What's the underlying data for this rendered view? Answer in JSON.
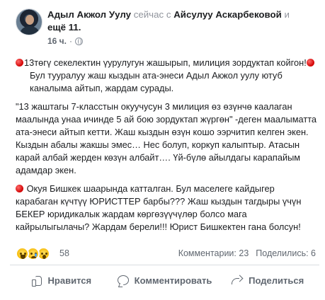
{
  "post": {
    "author": "Адыл Акжол Уулу",
    "with_prefix": "сейчас с",
    "tagged": "Айсулуу Аскарбековой",
    "and_text": "и",
    "others": "ещё 11",
    "period": ".",
    "time": "16 ч.",
    "middot": "·",
    "privacy_icon": "globe-icon",
    "paragraphs": [
      "13төгү секелектин үурулугун жашырып, милиция зордуктап койгон!",
      "Бул тууралуу жаш кыздын ата-энеси Адыл Акжол уулу ютуб каналыма айтып, жардам сурады.",
      "\"13 жаштагы 7-класстын окуучусун 3 милиция өз өзүнчө каалаган маалында унаа ичинде 5 ай бою зордуктап жүргөн\" -деген маалыматта ата-энеси айтып кетти. Жаш кыздын өзүн кошо ээрчитип келген экен. Кыздын абалы жакшы эмес… Нес болуп, коркуп калыптыр. Атасын карай албай жерден көзүн албайт…. Үй-бүлө айылдагы карапайым адамдар экен.",
      "Окуя Бишкек шаарында катталган. Бул маселеге кайдыгер карабаган күчтүү ЮРИСТТЕР барбы??? Жаш кыздын тагдыры үчүн БЕКЕР юридикалык жардам көргөзүүчүлөр болсо мага кайрылыгылачы?  Жардам берели!!! Юрист Бишкектен гана болсун!"
    ],
    "emoji_red_circle": "red-circle-emoji"
  },
  "engagement": {
    "reaction_icons": [
      "haha-reaction",
      "sad-reaction",
      "wow-reaction"
    ],
    "reaction_count": "58",
    "comments": "Комментарии: 23",
    "shares": "Поделились: 6"
  },
  "actions": {
    "like": "Нравится",
    "comment": "Комментировать",
    "share": "Поделиться"
  },
  "colors": {
    "text": "#1c1e21",
    "muted": "#90949c",
    "action_text": "#606770",
    "divider": "#dadde1"
  }
}
